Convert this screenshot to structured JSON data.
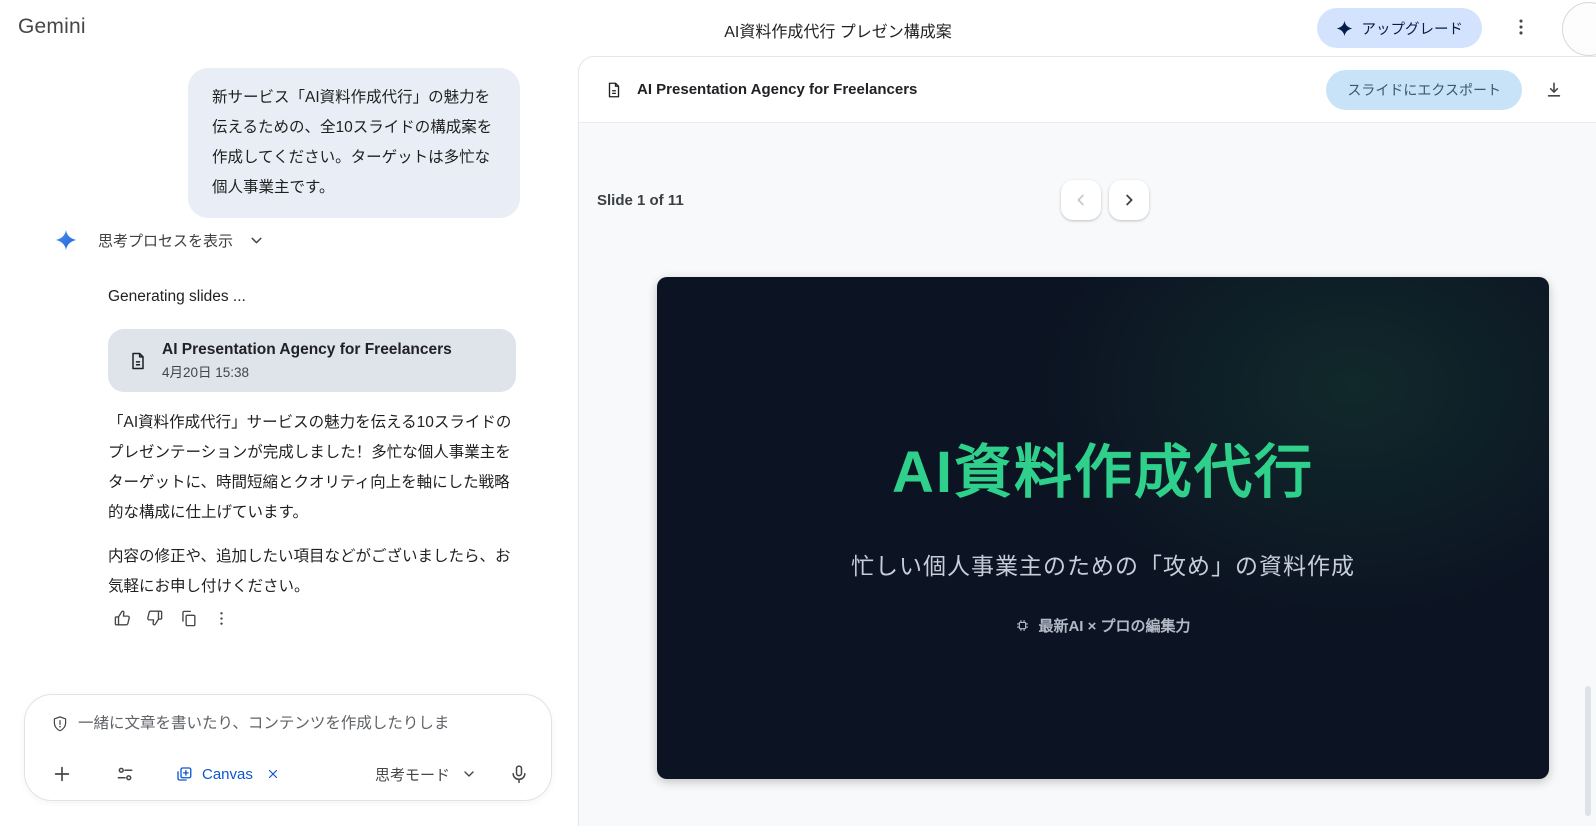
{
  "topbar": {
    "logo": "Gemini",
    "title": "AI資料作成代行 プレゼン構成案",
    "upgrade_label": "アップグレード"
  },
  "chat": {
    "user_message": "新サービス「AI資料作成代行」の魅力を伝えるための、全10スライドの構成案を作成してください。ターゲットは多忙な個人事業主です。",
    "thought_toggle_label": "思考プロセスを表示",
    "status_text": "Generating slides ...",
    "file_card": {
      "title": "AI Presentation Agency for Freelancers",
      "timestamp": "4月20日 15:38"
    },
    "paragraphs": [
      "「AI資料作成代行」サービスの魅力を伝える10スライドのプレゼンテーションが完成しました！多忙な個人事業主をターゲットに、時間短縮とクオリティ向上を軸にした戦略的な構成に仕上げています。",
      "内容の修正や、追加したい項目などがございましたら、お気軽にお申し付けください。"
    ],
    "action_icons": [
      "thumbs-up",
      "thumbs-down",
      "copy",
      "more"
    ]
  },
  "composer": {
    "placeholder": "一緒に文章を書いたり、コンテンツを作成したりしま",
    "canvas_chip_label": "Canvas",
    "mode_label": "思考モード",
    "icons": [
      "shield",
      "plus",
      "tune",
      "canvas",
      "close",
      "chevron-down",
      "microphone"
    ]
  },
  "canvas": {
    "doc_title": "AI Presentation Agency for Freelancers",
    "export_label": "スライドにエクスポート",
    "slide_counter": "Slide 1 of 11",
    "slide": {
      "title": "AI資料作成代行",
      "subtitle": "忙しい個人事業主のための「攻め」の資料作成",
      "tagline": "最新AI × プロの編集力"
    }
  },
  "colors": {
    "accent_blue": "#0b57d0",
    "upgrade_pill_bg": "#d3e3fd",
    "export_pill_bg": "#c8e3f8",
    "user_bubble_bg": "#e9eef6",
    "file_card_bg": "#dfe3ea",
    "slide_bg": "#0c1322",
    "slide_title_green": "#2ed08c"
  }
}
